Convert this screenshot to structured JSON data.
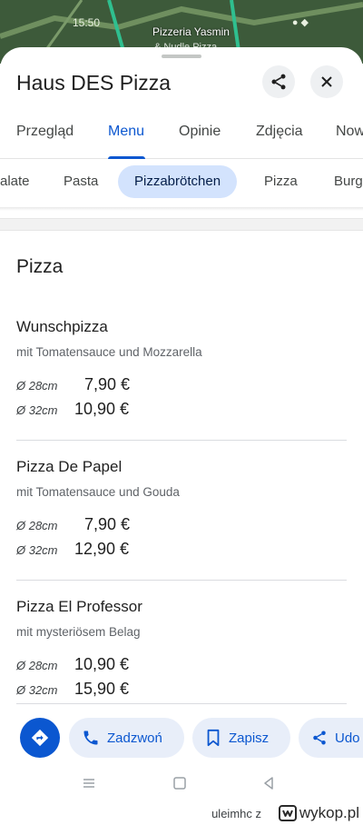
{
  "map": {
    "status_time": "15:50",
    "status_right": "●  ◆",
    "label_primary": "Pizzeria Yasmin",
    "label_secondary": "& Nudle Pizza"
  },
  "header": {
    "title": "Haus DES Pizza",
    "share_icon": "share-icon",
    "close_icon": "close-icon"
  },
  "tabs": [
    {
      "label": "Przegląd",
      "active": false
    },
    {
      "label": "Menu",
      "active": true
    },
    {
      "label": "Opinie",
      "active": false
    },
    {
      "label": "Zdjęcia",
      "active": false
    },
    {
      "label": "Now",
      "active": false
    }
  ],
  "chips": [
    {
      "label": "alate",
      "active": false
    },
    {
      "label": "Pasta",
      "active": false
    },
    {
      "label": "Pizzabrötchen",
      "active": true
    },
    {
      "label": "Pizza",
      "active": false
    },
    {
      "label": "Burg",
      "active": false
    }
  ],
  "section": {
    "title": "Pizza"
  },
  "items": [
    {
      "name": "Wunschpizza",
      "desc": "mit Tomatensauce und Mozzarella",
      "prices": [
        {
          "size": "Ø 28cm",
          "price": "7,90 €"
        },
        {
          "size": "Ø 32cm",
          "price": "10,90 €"
        }
      ]
    },
    {
      "name": "Pizza De Papel",
      "desc": "mit Tomatensauce und Gouda",
      "prices": [
        {
          "size": "Ø 28cm",
          "price": "7,90 €"
        },
        {
          "size": "Ø 32cm",
          "price": "12,90 €"
        }
      ]
    },
    {
      "name": "Pizza El Professor",
      "desc": "mit mysteriösem Belag",
      "prices": [
        {
          "size": "Ø 28cm",
          "price": "10,90 €"
        },
        {
          "size": "Ø 32cm",
          "price": "15,90 €"
        }
      ]
    }
  ],
  "actions": {
    "directions_icon": "directions-icon",
    "call_label": "Zadzwoń",
    "save_label": "Zapisz",
    "share_label": "Udo"
  },
  "watermark": {
    "user": "uleimhc  z",
    "site": "wykop.pl"
  },
  "colors": {
    "accent": "#0b57d0",
    "chip_active_bg": "#d3e3fd",
    "pill_bg": "#e8eef9"
  }
}
